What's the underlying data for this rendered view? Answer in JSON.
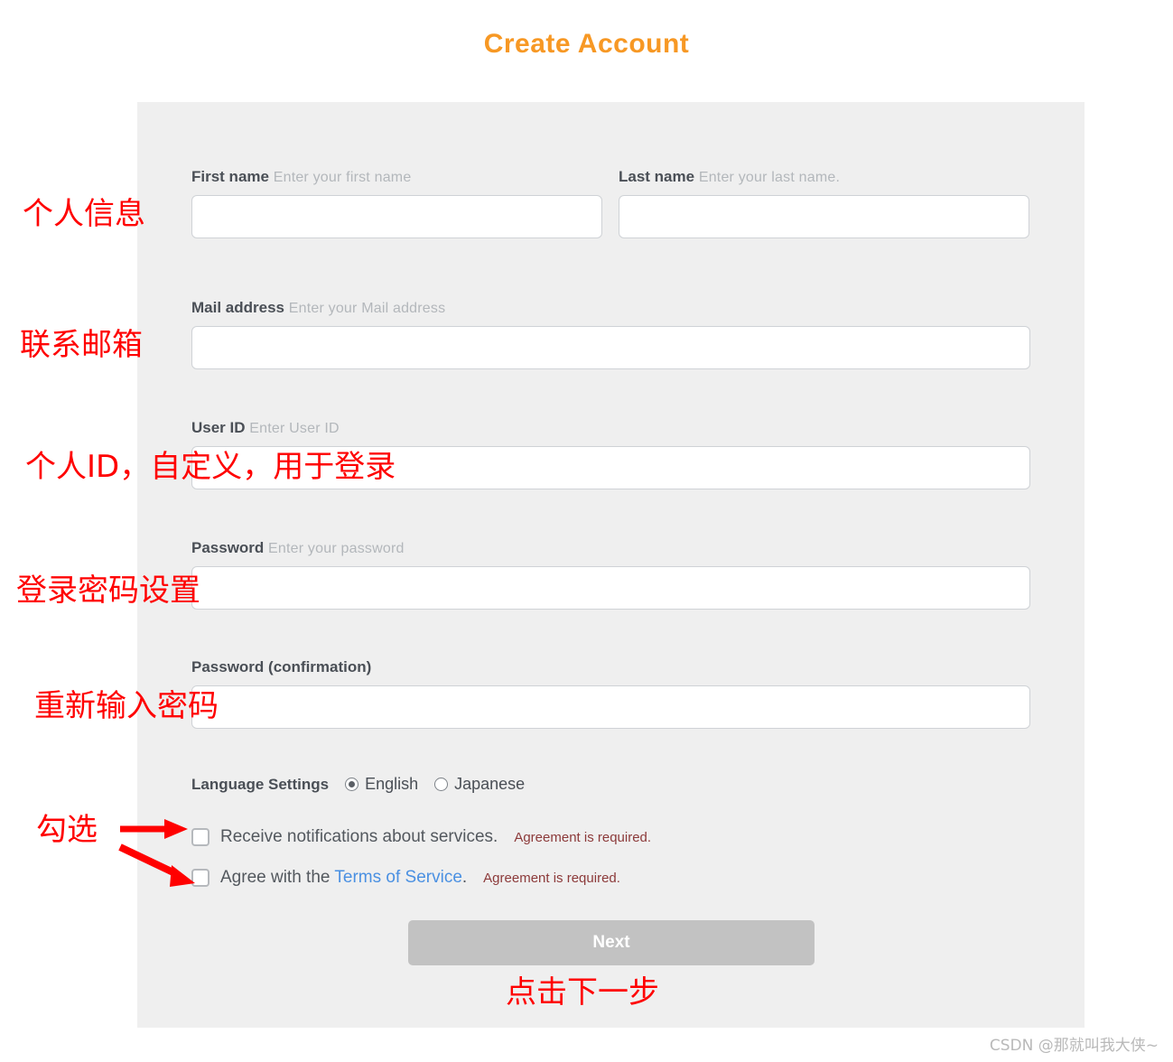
{
  "page": {
    "title": "Create Account",
    "title_color": "#f79824",
    "background": "#ffffff",
    "card_background": "#efefef"
  },
  "form": {
    "fields": [
      {
        "label": "First name",
        "hint": "Enter your first name",
        "value": "",
        "type": "text"
      },
      {
        "label": "Last name",
        "hint": "Enter your last name.",
        "value": "",
        "type": "text"
      },
      {
        "label": "Mail address",
        "hint": "Enter your Mail address",
        "value": "",
        "type": "email"
      },
      {
        "label": "User ID",
        "hint": "Enter User ID",
        "value": "",
        "type": "text"
      },
      {
        "label": "Password",
        "hint": "Enter your password",
        "value": "",
        "type": "password"
      },
      {
        "label": "Password (confirmation)",
        "hint": "",
        "value": "",
        "type": "password"
      }
    ],
    "language": {
      "title": "Language Settings",
      "options": [
        {
          "label": "English",
          "selected": true
        },
        {
          "label": "Japanese",
          "selected": false
        }
      ]
    },
    "checkboxes": [
      {
        "label": "Receive notifications about services.",
        "note": "Agreement is required.",
        "checked": false,
        "link": ""
      },
      {
        "label_before": "Agree with the ",
        "link": "Terms of Service",
        "label_after": ".",
        "note": "Agreement is required.",
        "checked": false
      }
    ],
    "submit": {
      "label": "Next",
      "enabled": false,
      "background": "#c2c2c2"
    }
  },
  "annotations": {
    "color": "#ff0000",
    "personal_info": "个人信息",
    "contact_email": "联系邮箱",
    "user_id": "个人ID，自定义，用于登录",
    "password": "登录密码设置",
    "password_confirm": "重新输入密码",
    "check_these": "勾选",
    "click_next": "点击下一步"
  },
  "watermark": {
    "text": "CSDN @那就叫我大侠~"
  }
}
